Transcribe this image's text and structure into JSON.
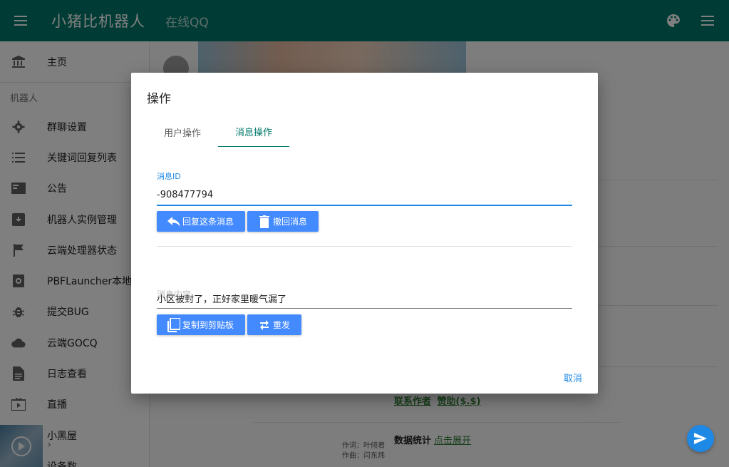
{
  "appbar": {
    "title": "小猪比机器人",
    "subtitle": "在线QQ"
  },
  "drawer": {
    "home_label": "主页",
    "section_header": "机器人",
    "items": [
      {
        "label": "群聊设置",
        "icon": "gear-icon"
      },
      {
        "label": "关键词回复列表",
        "icon": "list-icon"
      },
      {
        "label": "公告",
        "icon": "announcement-icon"
      },
      {
        "label": "机器人实例管理",
        "icon": "archive-icon"
      },
      {
        "label": "云端处理器状态",
        "icon": "flag-icon"
      },
      {
        "label": "PBFLauncher本地版",
        "icon": "launcher-icon"
      },
      {
        "label": "提交BUG",
        "icon": "bug-icon"
      },
      {
        "label": "云端GOCQ",
        "icon": "cloud-icon"
      },
      {
        "label": "日志查看",
        "icon": "document-icon"
      },
      {
        "label": "直播",
        "icon": "tv-icon"
      },
      {
        "label": "小黑屋",
        "icon": "block-icon"
      },
      {
        "label": "设备数",
        "icon": "device-icon"
      }
    ]
  },
  "background": {
    "footer_links": [
      "联系作者",
      "赞助($.$)"
    ],
    "stats_label": "数据统计",
    "stats_link": "点击展开",
    "lyric_line1": "作词：叶倾君",
    "lyric_line2": "作曲：闫东炜"
  },
  "dialog": {
    "title": "操作",
    "tabs": [
      "用户操作",
      "消息操作"
    ],
    "active_tab": 1,
    "message_id_label": "消息ID",
    "message_id_value": "-908477794",
    "reply_button": "回复这条消息",
    "recall_button": "撤回消息",
    "message_content_label": "消息内容",
    "message_content_value": "小区被封了，正好家里暖气漏了",
    "copy_button": "复制到剪贴板",
    "resend_button": "重发",
    "cancel_button": "取消"
  },
  "colors": {
    "appbar": "#00796b",
    "button": "#448aff",
    "accent": "#1e88e5",
    "link": "#2e7d32"
  }
}
